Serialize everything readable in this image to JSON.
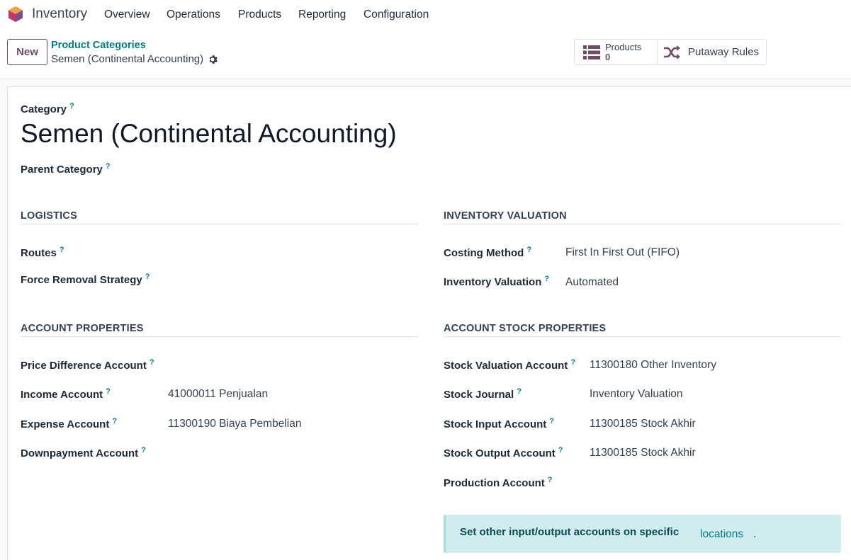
{
  "navbar": {
    "app_name": "Inventory",
    "menu": [
      "Overview",
      "Operations",
      "Products",
      "Reporting",
      "Configuration"
    ],
    "logo_colors": [
      "#f0a045",
      "#c3346b",
      "#7a4e8b"
    ]
  },
  "control_panel": {
    "new_label": "New",
    "breadcrumb_parent": "Product Categories",
    "breadcrumb_current": "Semen (Continental Accounting)",
    "smart_products_label": "Products",
    "smart_products_value": "0",
    "smart_putaway_label": "Putaway Rules"
  },
  "form": {
    "category_label": "Category",
    "title": "Semen (Continental Accounting)",
    "parent_category_label": "Parent Category",
    "help_mark": "?",
    "logistics": {
      "title": "LOGISTICS",
      "routes_label": "Routes",
      "force_removal_label": "Force Removal Strategy"
    },
    "inventory_valuation": {
      "title": "INVENTORY VALUATION",
      "costing_method_label": "Costing Method",
      "costing_method_value": "First In First Out (FIFO)",
      "inventory_valuation_label": "Inventory Valuation",
      "inventory_valuation_value": "Automated"
    },
    "account_properties": {
      "title": "ACCOUNT PROPERTIES",
      "price_diff_label": "Price Difference Account",
      "income_label": "Income Account",
      "income_value": "41000011 Penjualan",
      "expense_label": "Expense Account",
      "expense_value": "11300190 Biaya Pembelian",
      "downpayment_label": "Downpayment Account"
    },
    "account_stock_properties": {
      "title": "ACCOUNT STOCK PROPERTIES",
      "stock_valuation_label": "Stock Valuation Account",
      "stock_valuation_value": "11300180 Other Inventory",
      "stock_journal_label": "Stock Journal",
      "stock_journal_value": "Inventory Valuation",
      "stock_input_label": "Stock Input Account",
      "stock_input_value": "11300185 Stock Akhir",
      "stock_output_label": "Stock Output Account",
      "stock_output_value": "11300185 Stock Akhir",
      "production_label": "Production Account"
    },
    "alert": {
      "text": "Set other input/output accounts on specific",
      "link": "locations",
      "tail": "."
    }
  },
  "colors": {
    "brand": "#714b67",
    "link": "#017e84",
    "alert_bg": "#d1ecf1"
  }
}
